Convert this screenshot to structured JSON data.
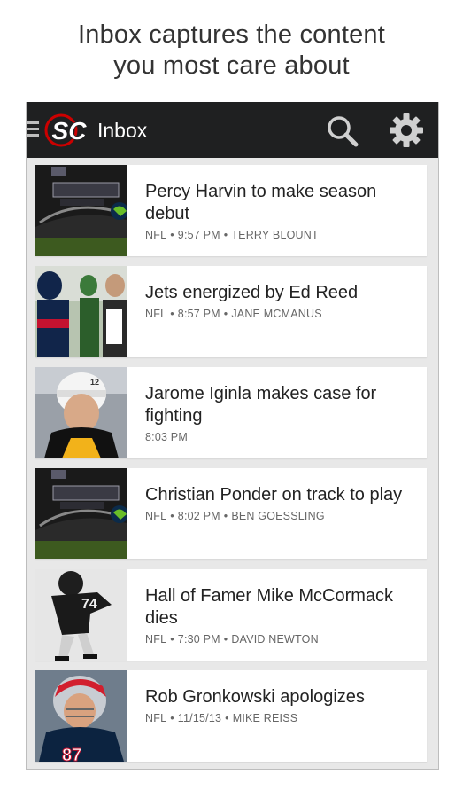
{
  "headline": {
    "line1": "Inbox captures the content",
    "line2": "you most care about"
  },
  "appbar": {
    "logo_text": "SC",
    "title": "Inbox",
    "icons": [
      "menu-icon",
      "sportscenter-logo",
      "search-icon",
      "gear-icon"
    ]
  },
  "colors": {
    "appbar_bg": "#1f2021",
    "accent_red": "#cc0000",
    "list_bg": "#e8e8e8",
    "card_bg": "#ffffff"
  },
  "items": [
    {
      "title": "Percy Harvin to make season debut",
      "league": "NFL",
      "sep1": "•",
      "time": "9:57 PM",
      "sep2": "•",
      "author": "TERRY BLOUNT",
      "thumb": "countdown-daily-thumbnail"
    },
    {
      "title": "Jets energized by Ed Reed",
      "league": "NFL",
      "sep1": "•",
      "time": "8:57 PM",
      "sep2": "•",
      "author": "JANE MCMANUS",
      "thumb": "football-players-thumbnail"
    },
    {
      "title": "Jarome Iginla makes case for fighting",
      "league": "",
      "sep1": "",
      "time": "8:03 PM",
      "sep2": "",
      "author": "",
      "thumb": "hockey-player-thumbnail"
    },
    {
      "title": "Christian Ponder on track to play",
      "league": "NFL",
      "sep1": "•",
      "time": "8:02 PM",
      "sep2": "•",
      "author": "BEN GOESSLING",
      "thumb": "countdown-daily-thumbnail"
    },
    {
      "title": "Hall of Famer Mike McCormack dies",
      "league": "NFL",
      "sep1": "•",
      "time": "7:30 PM",
      "sep2": "•",
      "author": "DAVID NEWTON",
      "thumb": "vintage-player-thumbnail"
    },
    {
      "title": "Rob Gronkowski apologizes",
      "league": "NFL",
      "sep1": "•",
      "time": "11/15/13",
      "sep2": "•",
      "author": "MIKE REISS",
      "thumb": "patriots-player-thumbnail"
    }
  ]
}
